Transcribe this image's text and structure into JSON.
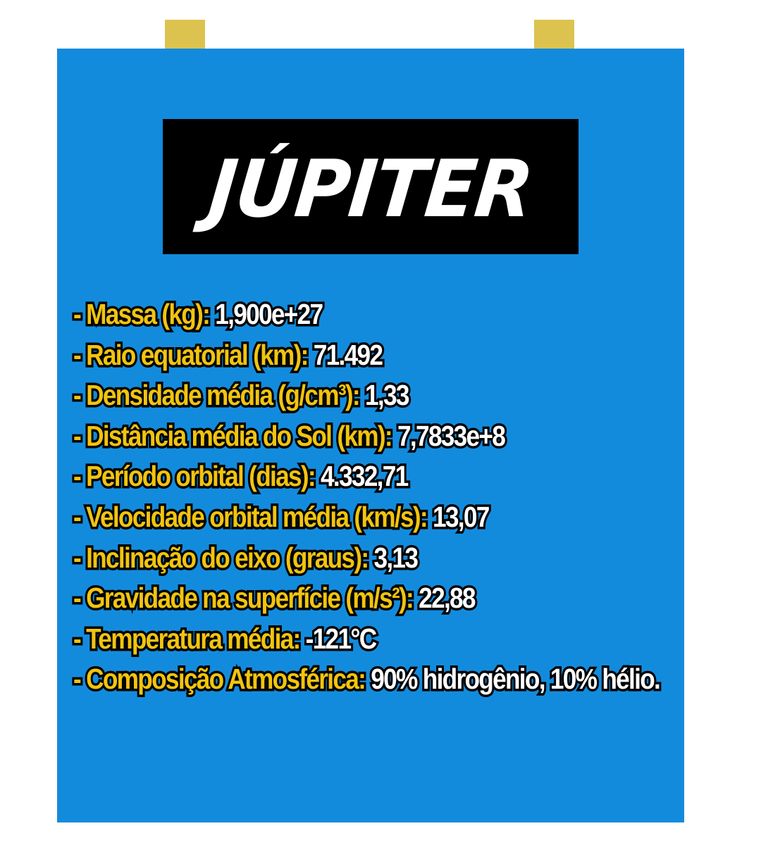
{
  "title": "JÚPITER",
  "colors": {
    "card_background": "#138bdd",
    "tab": "#dcc34f",
    "title_box": "#000000",
    "key_text": "#f1c40f",
    "value_text": "#ffffff"
  },
  "facts": [
    {
      "key": "- Massa (kg):",
      "value": "1,900e+27"
    },
    {
      "key": "- Raio equatorial (km):",
      "value": "71.492"
    },
    {
      "key": "- Densidade média (g/cm³):",
      "value": "1,33"
    },
    {
      "key": "- Distância média do Sol (km):",
      "value": "7,7833e+8"
    },
    {
      "key": "- Período orbital (dias):",
      "value": "4.332,71"
    },
    {
      "key": "- Velocidade orbital média (km/s):",
      "value": "13,07"
    },
    {
      "key": "- Inclinação do eixo (graus):",
      "value": "3,13"
    },
    {
      "key": "- Gravidade na superfície (m/s²):",
      "value": "22,88"
    },
    {
      "key": "- Temperatura média:",
      "value": "-121°C"
    },
    {
      "key": "- Composição Atmosférica:",
      "value": "90% hidrogênio, 10% hélio."
    }
  ]
}
